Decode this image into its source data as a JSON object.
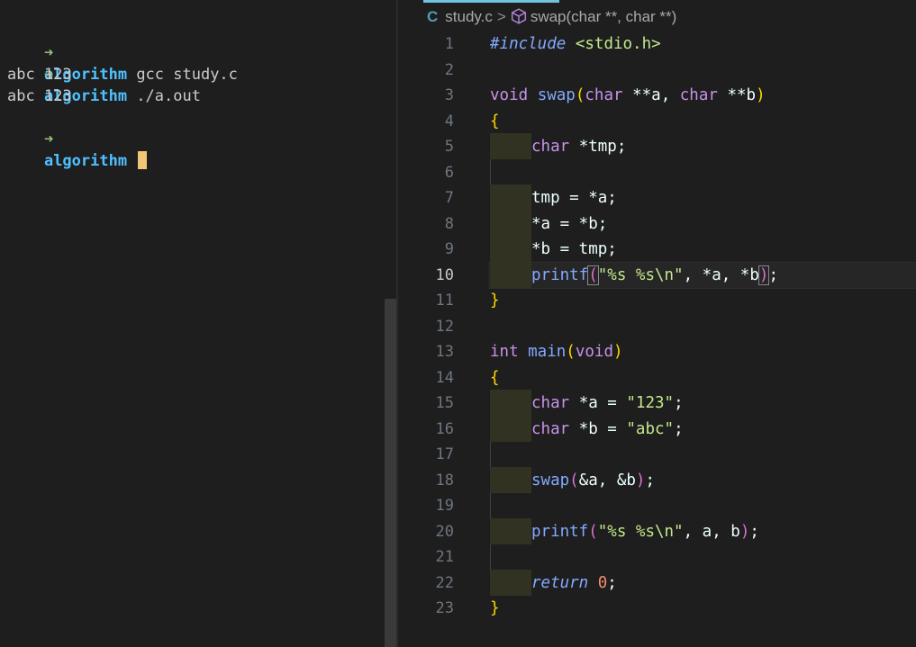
{
  "terminal": {
    "lines": [
      {
        "prompt": "➜",
        "dir": "algorithm",
        "cmd": " gcc study.c"
      },
      {
        "prompt": "➜",
        "dir": "algorithm",
        "cmd": " ./a.out"
      },
      {
        "output": "abc 123"
      },
      {
        "output": "abc 123"
      },
      {
        "prompt": "➜",
        "dir": "algorithm",
        "cmd": " "
      }
    ]
  },
  "editor": {
    "breadcrumb": {
      "lang_icon": "C",
      "file": "study.c",
      "separator": ">",
      "symbol_icon": "cube-icon",
      "symbol": "swap(char **, char **)"
    },
    "active_line": "10",
    "line_numbers": [
      "1",
      "2",
      "3",
      "4",
      "5",
      "6",
      "7",
      "8",
      "9",
      "10",
      "11",
      "12",
      "13",
      "14",
      "15",
      "16",
      "17",
      "18",
      "19",
      "20",
      "21",
      "22",
      "23"
    ],
    "code": {
      "l1_a": "#include",
      "l1_b": " <stdio.h>",
      "l3_void": "void",
      "l3_swap": " swap",
      "l3_p1": "(",
      "l3_char1": "char",
      "l3_a": " **a, ",
      "l3_char2": "char",
      "l3_b": " **b",
      "l3_p2": ")",
      "l4": "{",
      "l5_char": "char",
      "l5_rest": " *tmp;",
      "l7": "tmp = *a;",
      "l8": "*a = *b;",
      "l9": "*b = tmp;",
      "l10_fn": "printf",
      "l10_p1": "(",
      "l10_str": "\"%s %s\\n\"",
      "l10_rest": ", *a, *b",
      "l10_p2": ")",
      "l10_end": ";",
      "l11": "}",
      "l13_int": "int",
      "l13_main": " main",
      "l13_p1": "(",
      "l13_void": "void",
      "l13_p2": ")",
      "l14": "{",
      "l15_char": "char",
      "l15_mid": " *a = ",
      "l15_str": "\"123\"",
      "l15_end": ";",
      "l16_char": "char",
      "l16_mid": " *b = ",
      "l16_str": "\"abc\"",
      "l16_end": ";",
      "l18_fn": "swap",
      "l18_p1": "(",
      "l18_rest": "&a, &b",
      "l18_p2": ")",
      "l18_end": ";",
      "l20_fn": "printf",
      "l20_p1": "(",
      "l20_str": "\"%s %s\\n\"",
      "l20_rest": ", a, b",
      "l20_p2": ")",
      "l20_end": ";",
      "l22_ret": "return",
      "l22_num": " 0",
      "l22_end": ";",
      "l23": "}"
    }
  }
}
